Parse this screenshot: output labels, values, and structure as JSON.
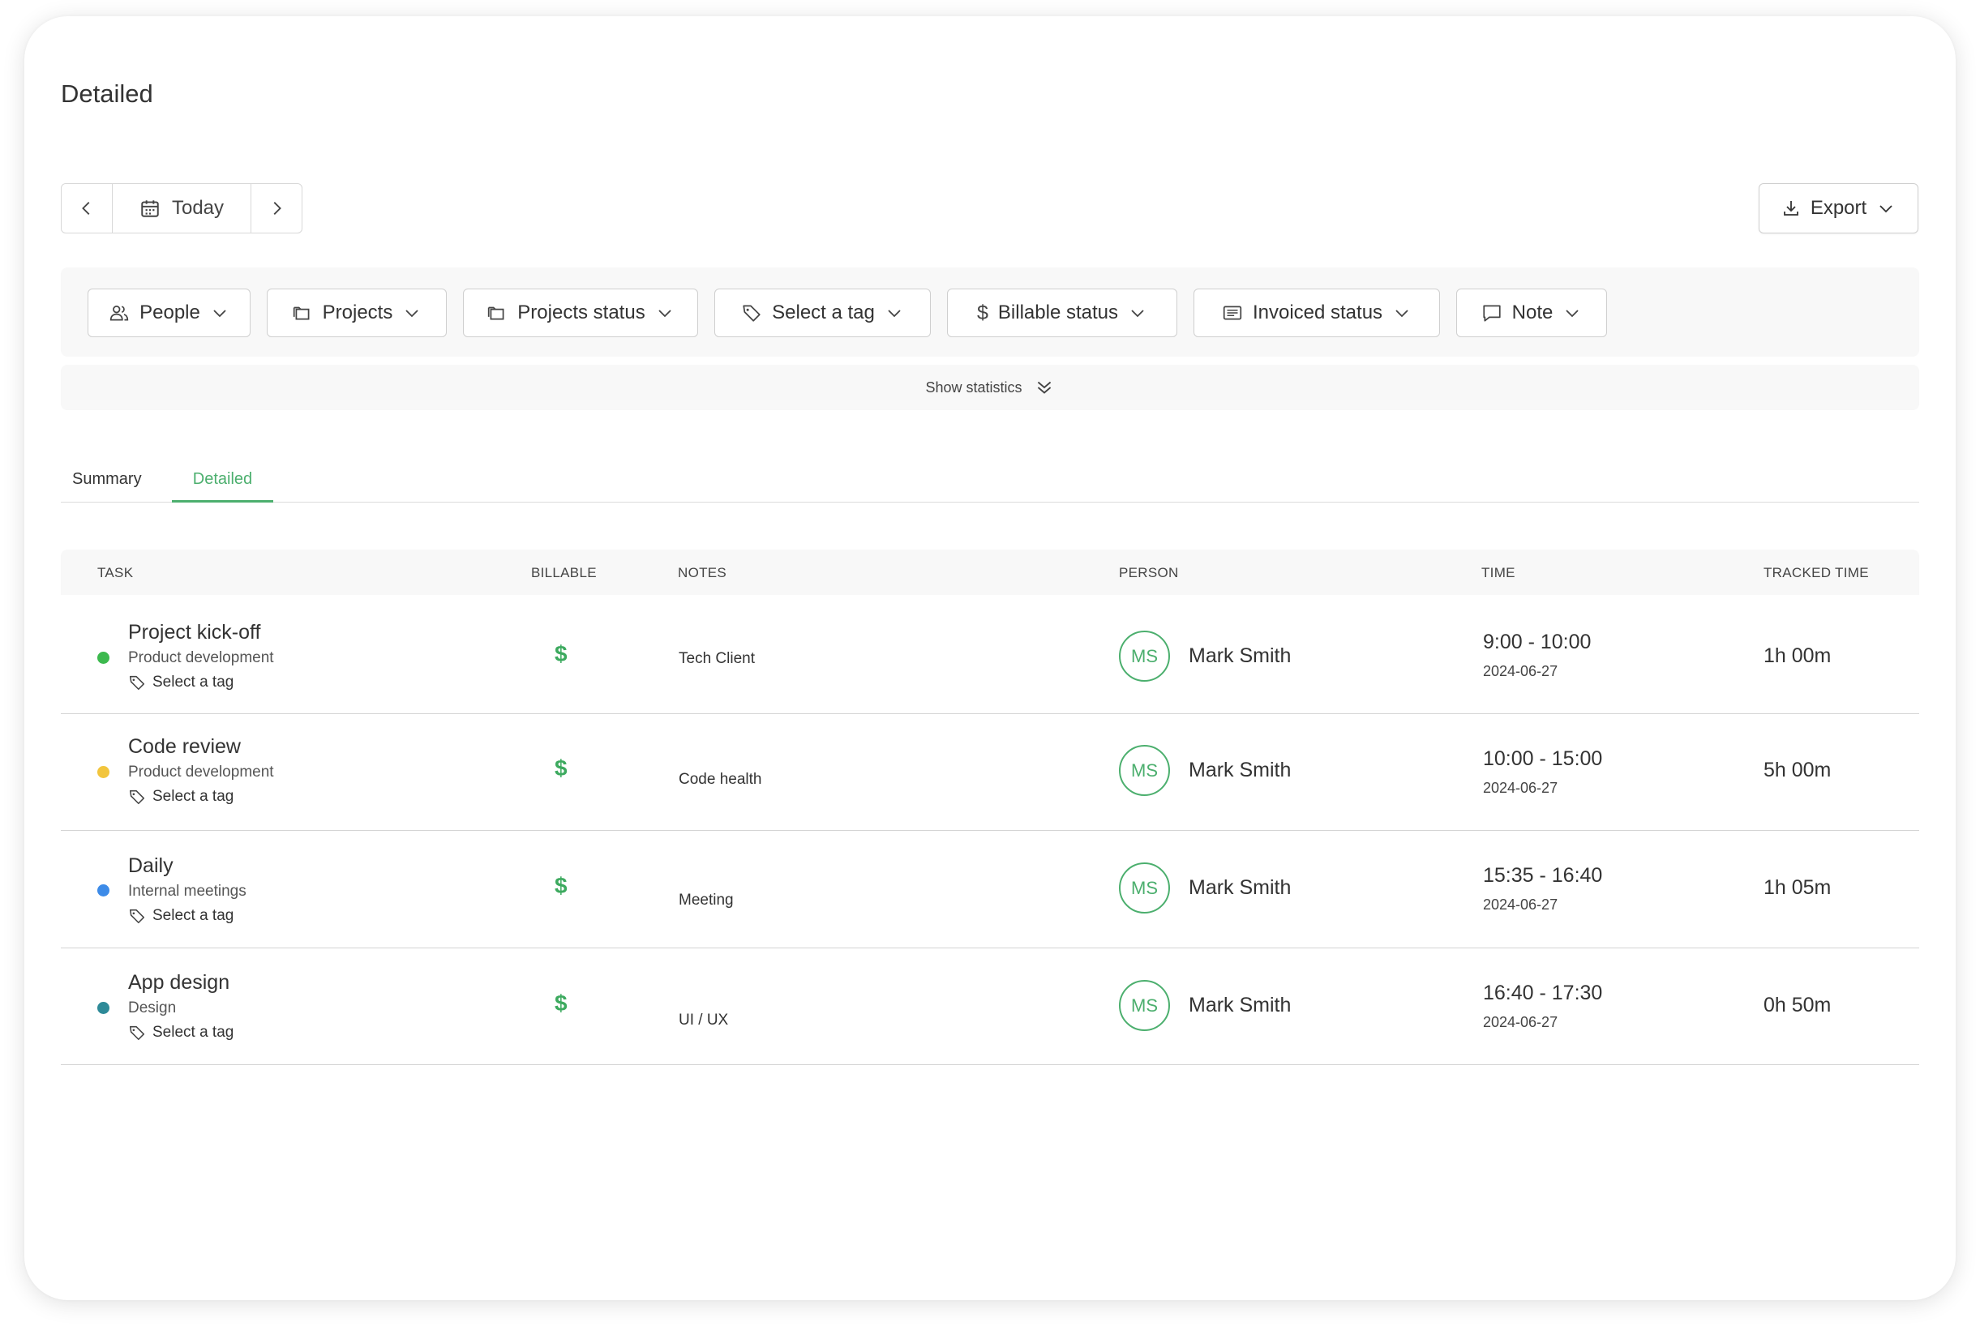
{
  "page": {
    "title": "Detailed"
  },
  "date_nav": {
    "label": "Today"
  },
  "export": {
    "label": "Export"
  },
  "filters": [
    {
      "label": "People",
      "icon": "people-icon"
    },
    {
      "label": "Projects",
      "icon": "folder-icon"
    },
    {
      "label": "Projects status",
      "icon": "folder-icon"
    },
    {
      "label": "Select a tag",
      "icon": "tag-icon"
    },
    {
      "label": "Billable status",
      "icon": "dollar-icon"
    },
    {
      "label": "Invoiced status",
      "icon": "invoice-icon"
    },
    {
      "label": "Note",
      "icon": "note-icon"
    }
  ],
  "statistics": {
    "label": "Show statistics"
  },
  "tabs": [
    {
      "label": "Summary",
      "active": false
    },
    {
      "label": "Detailed",
      "active": true
    }
  ],
  "table": {
    "headers": {
      "task": "TASK",
      "billable": "BILLABLE",
      "notes": "NOTES",
      "person": "PERSON",
      "time": "TIME",
      "tracked": "TRACKED TIME"
    },
    "billable_symbol": "$",
    "tag_label": "Select a tag",
    "rows": [
      {
        "title": "Project kick-off",
        "project": "Product development",
        "dot_color": "#3cb94e",
        "note": "Tech Client",
        "initials": "MS",
        "person": "Mark Smith",
        "time": "9:00 - 10:00",
        "date": "2024-06-27",
        "tracked": "1h 00m"
      },
      {
        "title": "Code review",
        "project": "Product development",
        "dot_color": "#f2c53d",
        "note": "Code health",
        "initials": "MS",
        "person": "Mark Smith",
        "time": "10:00 - 15:00",
        "date": "2024-06-27",
        "tracked": "5h 00m"
      },
      {
        "title": "Daily",
        "project": "Internal meetings",
        "dot_color": "#3d8be8",
        "note": "Meeting",
        "initials": "MS",
        "person": "Mark Smith",
        "time": "15:35 - 16:40",
        "date": "2024-06-27",
        "tracked": "1h 05m"
      },
      {
        "title": "App design",
        "project": "Design",
        "dot_color": "#2e8a98",
        "note": "UI / UX",
        "initials": "MS",
        "person": "Mark Smith",
        "time": "16:40 - 17:30",
        "date": "2024-06-27",
        "tracked": "0h 50m"
      }
    ]
  },
  "colors": {
    "accent": "#4caf6e",
    "billable": "#3daa5f"
  }
}
